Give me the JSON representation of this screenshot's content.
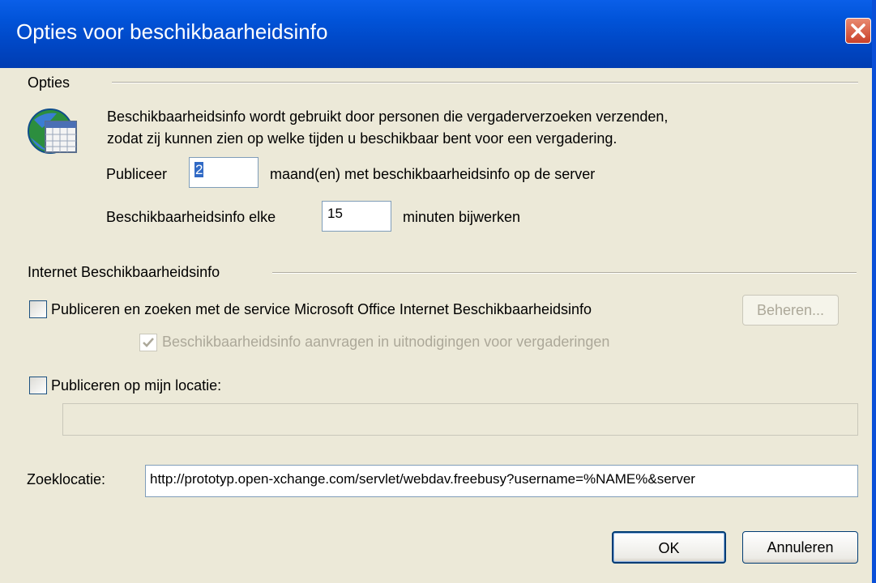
{
  "window": {
    "title": "Opties voor beschikbaarheidsinfo"
  },
  "options": {
    "heading": "Opties",
    "description_line1": "Beschikbaarheidsinfo wordt gebruikt door personen die vergaderverzoeken verzenden,",
    "description_line2": "zodat zij kunnen zien op welke tijden u beschikbaar bent voor een vergadering.",
    "publish_label": "Publiceer",
    "publish_months_value": "2",
    "publish_suffix": "maand(en) met beschikbaarheidsinfo op de server",
    "update_label": "Beschikbaarheidsinfo elke",
    "update_minutes_value": "15",
    "update_suffix": "minuten bijwerken",
    "icon": "calendar-globe-icon"
  },
  "internet": {
    "heading": "Internet Beschikbaarheidsinfo",
    "service_checkbox_label": "Publiceren en zoeken met de service Microsoft Office Internet Beschikbaarheidsinfo",
    "service_checked": false,
    "manage_button": "Beheren...",
    "request_checkbox_label": "Beschikbaarheidsinfo aanvragen in uitnodigingen voor vergaderingen",
    "request_checked": true,
    "location_checkbox_label": "Publiceren op mijn locatie:",
    "location_checked": false,
    "location_value": "",
    "search_label": "Zoeklocatie:",
    "search_value": "http://prototyp.open-xchange.com/servlet/webdav.freebusy?username=%NAME%&server"
  },
  "buttons": {
    "ok": "OK",
    "cancel": "Annuleren"
  },
  "colors": {
    "titlebar": "#0054E3",
    "dialog_bg": "#ECE9D8",
    "close_button": "#D85B3D"
  }
}
